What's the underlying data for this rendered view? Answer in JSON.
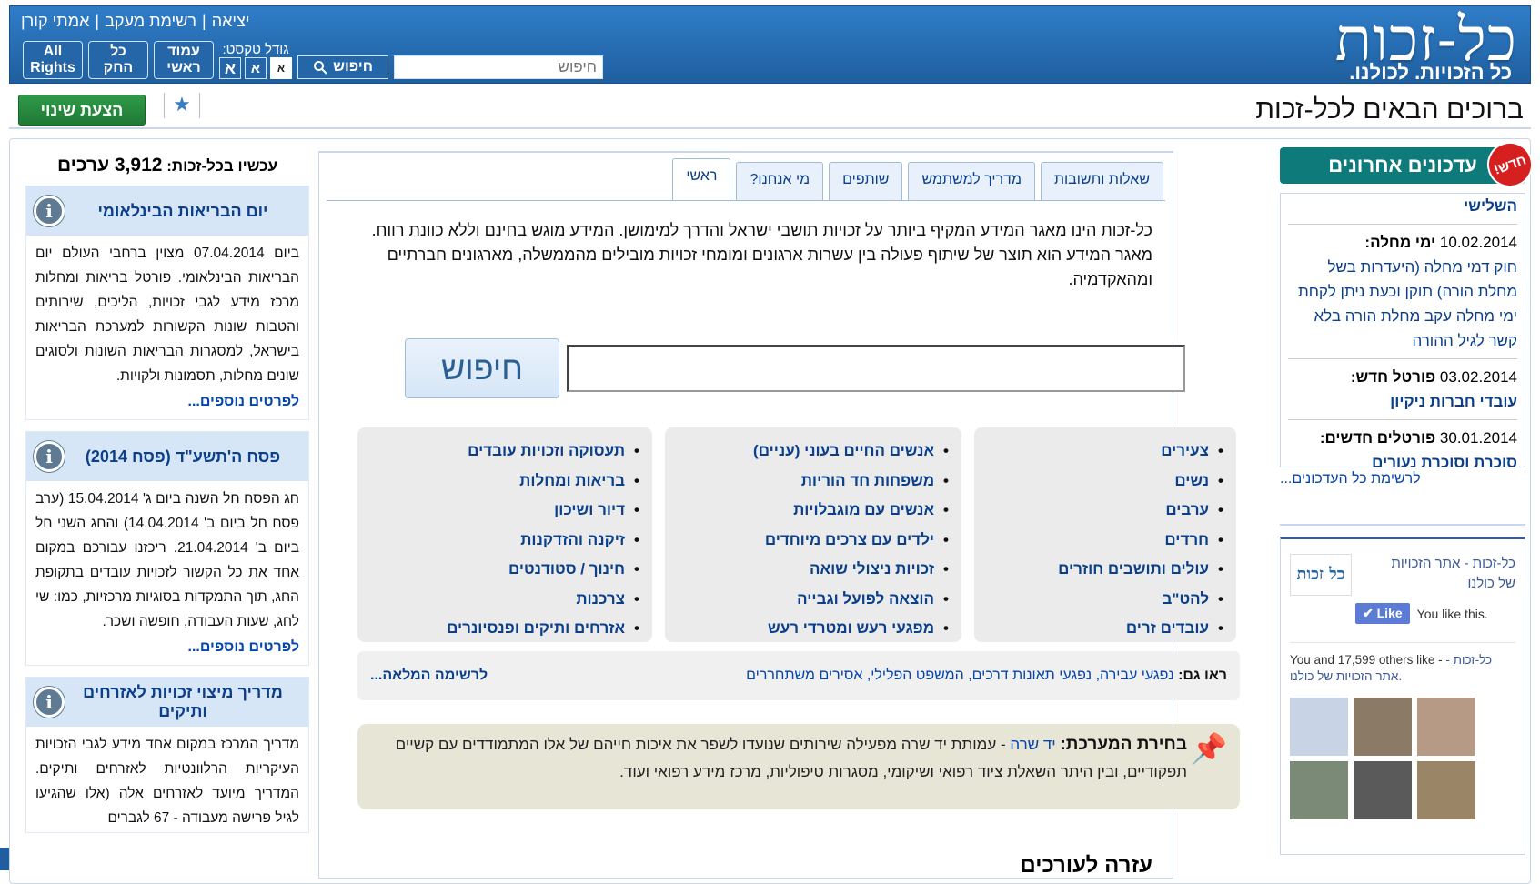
{
  "header": {
    "logo": "כל-זכות",
    "tagline": "כל הזכויות. לכולנו.",
    "links": [
      "אמתי קורן",
      "רשימת מעקב",
      "יציאה"
    ],
    "toolbar": {
      "all_rights": "All Rights",
      "kol_hak": "כל החק",
      "home_page": "עמוד ראשי",
      "font_size_label": "גודל טקסט:",
      "font_sizes": [
        "א",
        "א",
        "א"
      ],
      "search_button": "חיפוש",
      "search_placeholder": "חיפוש"
    }
  },
  "page": {
    "title": "ברוכים הבאים לכל-זכות",
    "propose_change": "הצעת שינוי"
  },
  "left": {
    "now_label": "עכשיו בכל-זכות:",
    "now_count": "3,912 ערכים",
    "boxes": [
      {
        "title": "יום הבריאות הבינלאומי",
        "body": "ביום 07.04.2014 מצוין ברחבי העולם יום הבריאות הבינלאומי. פורטל בריאות ומחלות מרכז מידע לגבי זכויות, הליכים, שירותים והטבות שונות הקשורות למערכת הבריאות בישראל, למסגרות הבריאות השונות ולסוגים שונים מחלות, תסמונות ולקויות.",
        "more": "לפרטים נוספים..."
      },
      {
        "title": "פסח ה'תשע\"ד (פסח 2014)",
        "body": "חג הפסח חל השנה ביום ג' 15.04.2014 (ערב פסח חל ביום ב' 14.04.2014) והחג השני חל ביום ב' 21.04.2014. ריכזנו עבורכם במקום אחד את כל הקשור לזכויות עובדים בתקופת החג, תוך התמקדות בסוגיות מרכזיות, כמו: שי לחג, שעות העבודה, חופשה ושכר.",
        "more": "לפרטים נוספים..."
      },
      {
        "title": "מדריך מיצוי זכויות לאזרחים ותיקים",
        "body": "מדריך המרכז במקום אחד מידע לגבי הזכויות העיקריות הרלוונטיות לאזרחים ותיקים. המדריך מיועד לאזרחים אלה (אלו שהגיעו לגיל פרישה מעבודה - 67 לגברים",
        "more": ""
      }
    ]
  },
  "center": {
    "tabs": [
      "ראשי",
      "מי אנחנו?",
      "שותפים",
      "מדריך למשתמש",
      "שאלות ותשובות"
    ],
    "intro": "כל-זכות הינו מאגר המידע המקיף ביותר על זכויות תושבי ישראל והדרך למימושן. המידע מוגש בחינם וללא כוונת רווח. מאגר המידע הוא תוצר של שיתוף פעולה בין עשרות ארגונים ומומחי זכויות מובילים מהממשלה, מארגונים חברתיים ומהאקדמיה.",
    "search_button": "חיפוש",
    "categories": [
      [
        "תעסוקה וזכויות עובדים",
        "בריאות ומחלות",
        "דיור ושיכון",
        "זיקנה והזדקנות",
        "חינוך / סטודנטים",
        "צרכנות",
        "אזרחים ותיקים ופנסיונרים"
      ],
      [
        "אנשים החיים בעוני (עניים)",
        "משפחות חד הוריות",
        "אנשים עם מוגבלויות",
        "ילדים עם צרכים מיוחדים",
        "זכויות ניצולי שואה",
        "הוצאה לפועל וגבייה",
        "מפגעי רעש ומטרדי רעש"
      ],
      [
        "צעירים",
        "נשים",
        "ערבים",
        "חרדים",
        "עולים ותושבים חוזרים",
        "להט\"ב",
        "עובדים זרים"
      ]
    ],
    "see_also_label": "ראו גם:",
    "see_also_links": "נפגעי עבירה, נפגעי תאונות דרכים, המשפט הפלילי, אסירים משתחררים",
    "full_list": "לרשימה המלאה...",
    "editor_pick_label": "בחירת המערכת:",
    "editor_pick_link": "יד שרה",
    "editor_pick_text": "- עמותת יד שרה מפעילה שירותים שנועדו לשפר את איכות חייהם של אלו המתמודדים עם קשיים תפקודיים, ובין היתר השאלת ציוד רפואי ושיקומי, מסגרות טיפוליות, מרכז מידע רפואי ועוד.",
    "help_heading": "עזרה לעורכים"
  },
  "right": {
    "updates_title": "עדכונים אחרונים",
    "new_badge": "חדש!",
    "updates": [
      {
        "date": "",
        "label": "",
        "text": "השלישי"
      },
      {
        "date": "10.02.2014",
        "label": "ימי מחלה:",
        "text": "חוק דמי מחלה (היעדרות בשל מחלת הורה) תוקן וכעת ניתן לקחת ימי מחלה עקב מחלת הורה בלא קשר לגיל ההורה"
      },
      {
        "date": "03.02.2014",
        "label": "פורטל חדש:",
        "text": "עובדי חברות ניקיון"
      },
      {
        "date": "30.01.2014",
        "label": "פורטלים חדשים:",
        "text": "סוכרת וסוכרת נעורים"
      }
    ],
    "all_updates": "לרשימת כל העדכונים...",
    "facebook": {
      "page_name": "כל-זכות - אתר הזכויות של כולנו",
      "logo_text": "כל זכות",
      "like_button": "Like",
      "you_like": "You like this.",
      "count_text": "You and 17,599 others like",
      "count_link": "כל-זכות - אתר הזכויות של כולנו."
    }
  }
}
